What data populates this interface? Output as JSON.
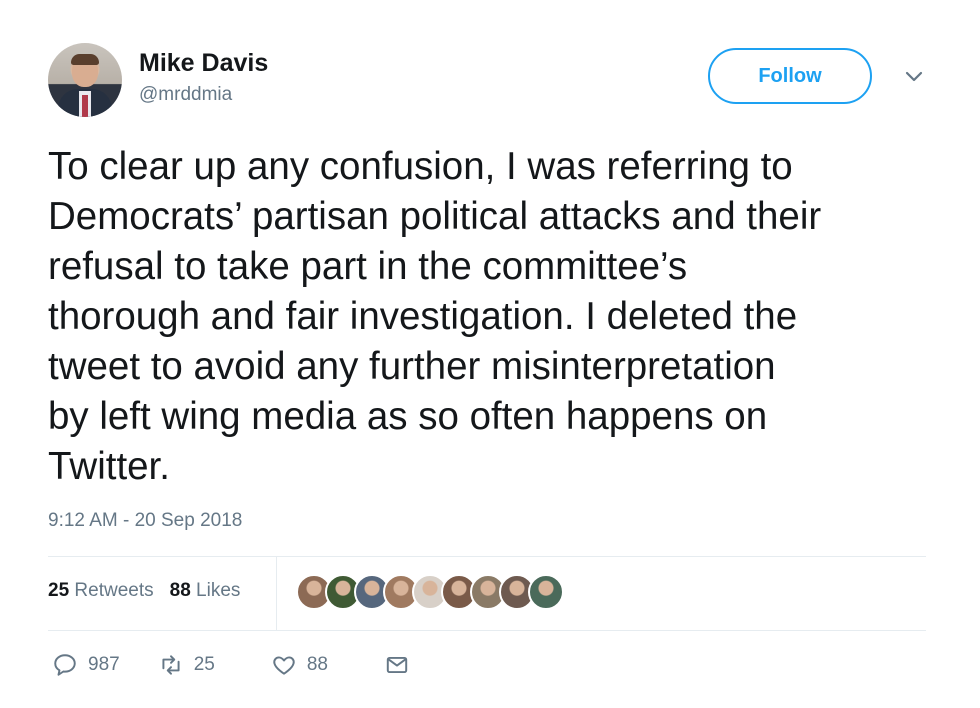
{
  "author": {
    "name": "Mike Davis",
    "handle": "@mrddmia"
  },
  "follow_label": "Follow",
  "tweet": {
    "text": "To clear up any confusion, I was referring to\nDemocrats’ partisan political attacks and their\nrefusal to take part in the committee’s\nthorough and fair investigation. I deleted the\ntweet to avoid any further misinterpretation\nby left wing media as so often happens on\nTwitter.",
    "timestamp": "9:12 AM - 20 Sep 2018"
  },
  "stats": {
    "retweets_count": "25",
    "retweets_label": "Retweets",
    "likes_count": "88",
    "likes_label": "Likes"
  },
  "liker_avatars": [
    "#8c6a55",
    "#3f5a34",
    "#56677d",
    "#a07a60",
    "#d8d0c8",
    "#7a5a48",
    "#8a7a66",
    "#6e5a50",
    "#4a6a5a"
  ],
  "actions": {
    "replies": "987",
    "retweets": "25",
    "likes": "88"
  },
  "colors": {
    "accent": "#1da1f2",
    "secondary_text": "#657786"
  }
}
